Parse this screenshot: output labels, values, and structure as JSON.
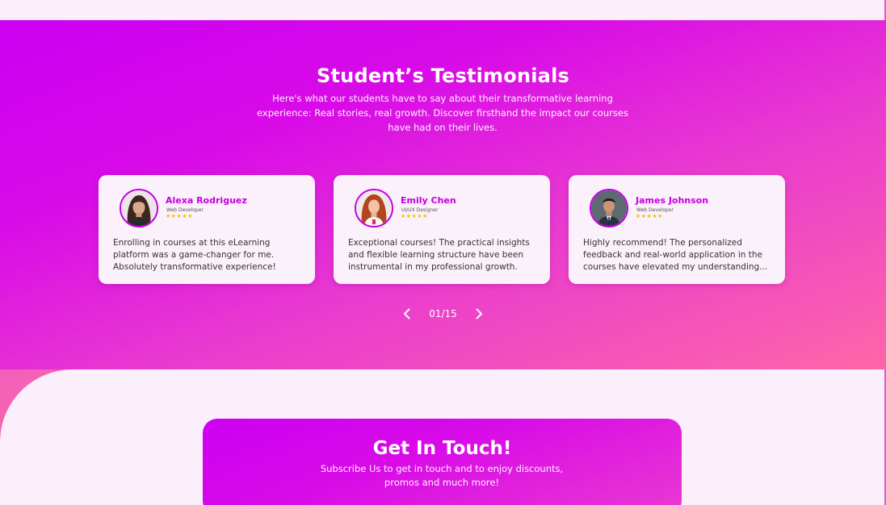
{
  "testimonials": {
    "title": "Student’s Testimonials",
    "subtitle": "Here's what our students have to say about their transformative learning experience: Real stories, real growth. Discover firsthand the impact our courses have had on their lives.",
    "cards": [
      {
        "name": "Alexa Rodriguez",
        "role": "Web Developer",
        "stars": "★★★★★",
        "rating": 5,
        "quote": "Enrolling in courses at this eLearning platform was a game-changer for me. Absolutely transformative experience!"
      },
      {
        "name": "Emily Chen",
        "role": "UI/UX Designer",
        "stars": "★★★★★",
        "rating": 5,
        "quote": "Exceptional courses! The practical insights and flexible learning structure have been instrumental in my professional growth."
      },
      {
        "name": "James Johnson",
        "role": "Web Developer",
        "stars": "★★★★★",
        "rating": 5,
        "quote": "Highly recommend! The personalized feedback and real-world application in the courses have elevated my understanding..."
      }
    ],
    "pager": {
      "count": "01/15",
      "prev_icon": "chevron-left-icon",
      "next_icon": "chevron-right-icon"
    }
  },
  "contact": {
    "title": "Get In Touch!",
    "subtitle": "Subscribe Us to get in touch and to enjoy discounts, promos and much more!"
  },
  "colors": {
    "accent": "#cc00f2",
    "accent_pink": "#ff66a8",
    "name_color": "#c400e0",
    "star_color": "#f2c200",
    "card_bg": "#fbf1fb",
    "page_bg": "#fbeffb"
  }
}
